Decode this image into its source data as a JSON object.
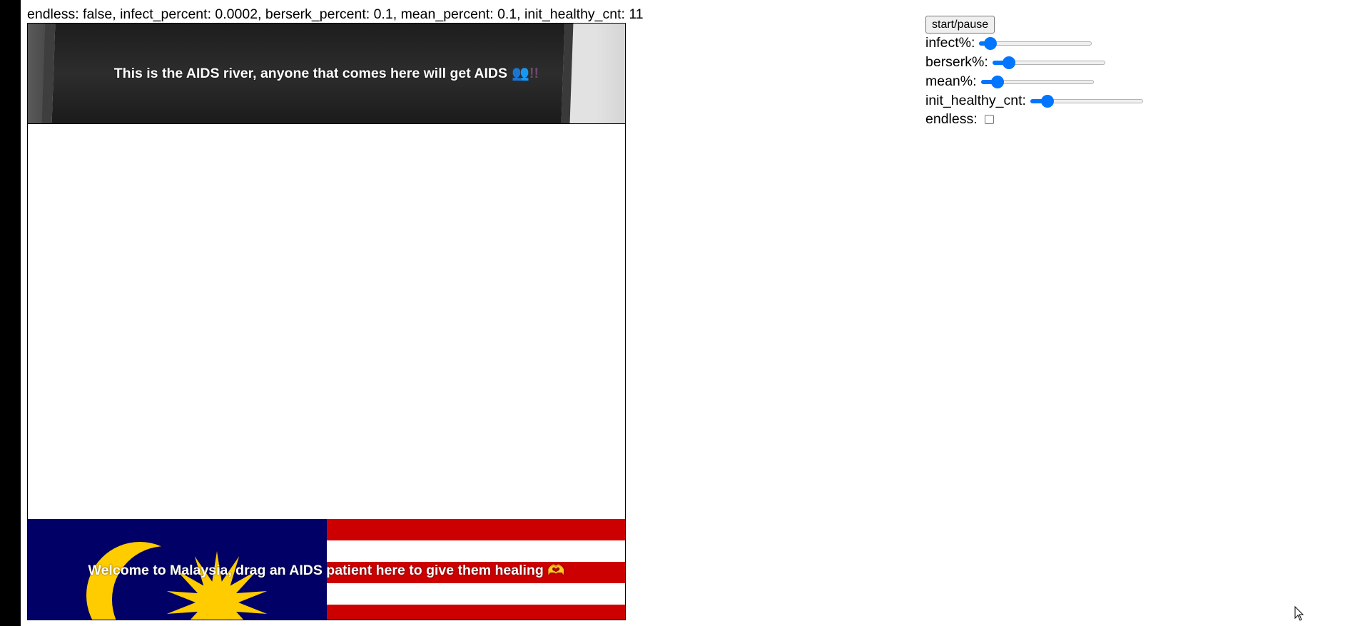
{
  "status_line": "endless: false, infect_percent: 0.0002, berserk_percent: 0.1, mean_percent: 0.1, init_healthy_cnt: 11",
  "river": {
    "text": "This is the AIDS river, anyone that comes here will get AIDS",
    "emoji": "👥!!"
  },
  "malaysia": {
    "text": "Welcome to Malaysia, drag an AIDS patient here to give them healing 🫶"
  },
  "controls": {
    "start_pause_label": "start/pause",
    "infect_label": "infect%:",
    "berserk_label": "berserk%:",
    "mean_label": "mean%:",
    "init_healthy_label": "init_healthy_cnt:",
    "endless_label": "endless:",
    "infect_level": 0.05,
    "berserk_level": 0.1,
    "mean_level": 0.1,
    "init_healthy_level": 0.11,
    "endless_checked": false
  },
  "colors": {
    "slider_accent": "#0075ff",
    "flag_red": "#cc0001",
    "flag_blue": "#010066",
    "flag_yellow": "#ffcc00"
  }
}
